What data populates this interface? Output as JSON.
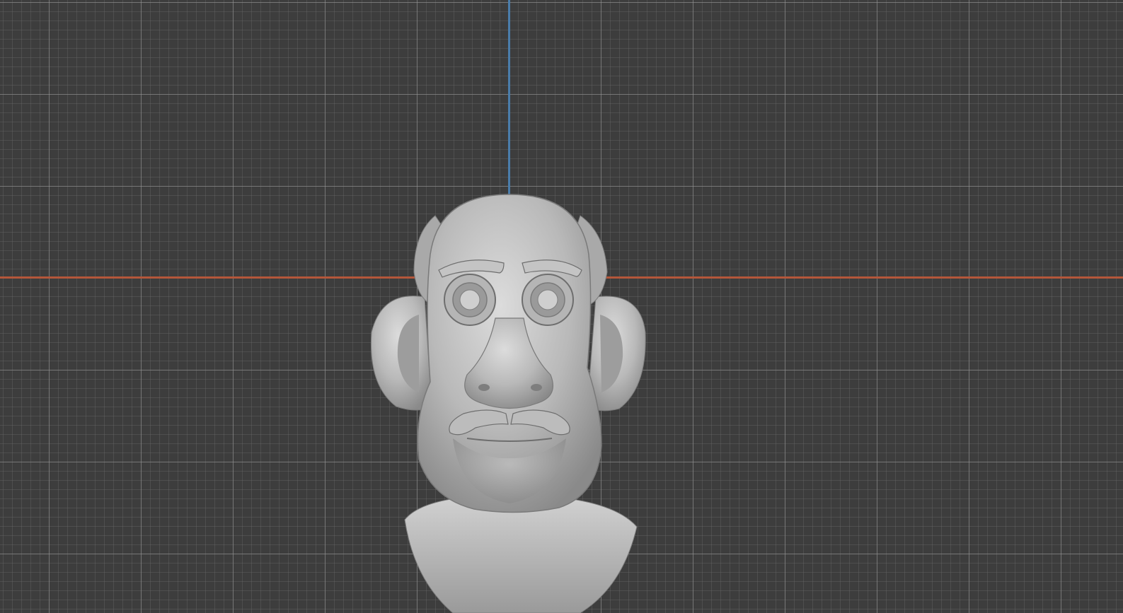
{
  "viewport": {
    "mode": "front-orthographic",
    "grid": true,
    "background_color": "#3d3d3d",
    "grid_color": "#969696"
  },
  "axes": {
    "x_axis_color": "#b4563a",
    "z_axis_color": "#4a7dab"
  },
  "object": {
    "type": "sculpt-bust",
    "subject": "cartoon-old-man-head",
    "material_color": "#b9b9b9",
    "shading": "solid-matcap"
  }
}
